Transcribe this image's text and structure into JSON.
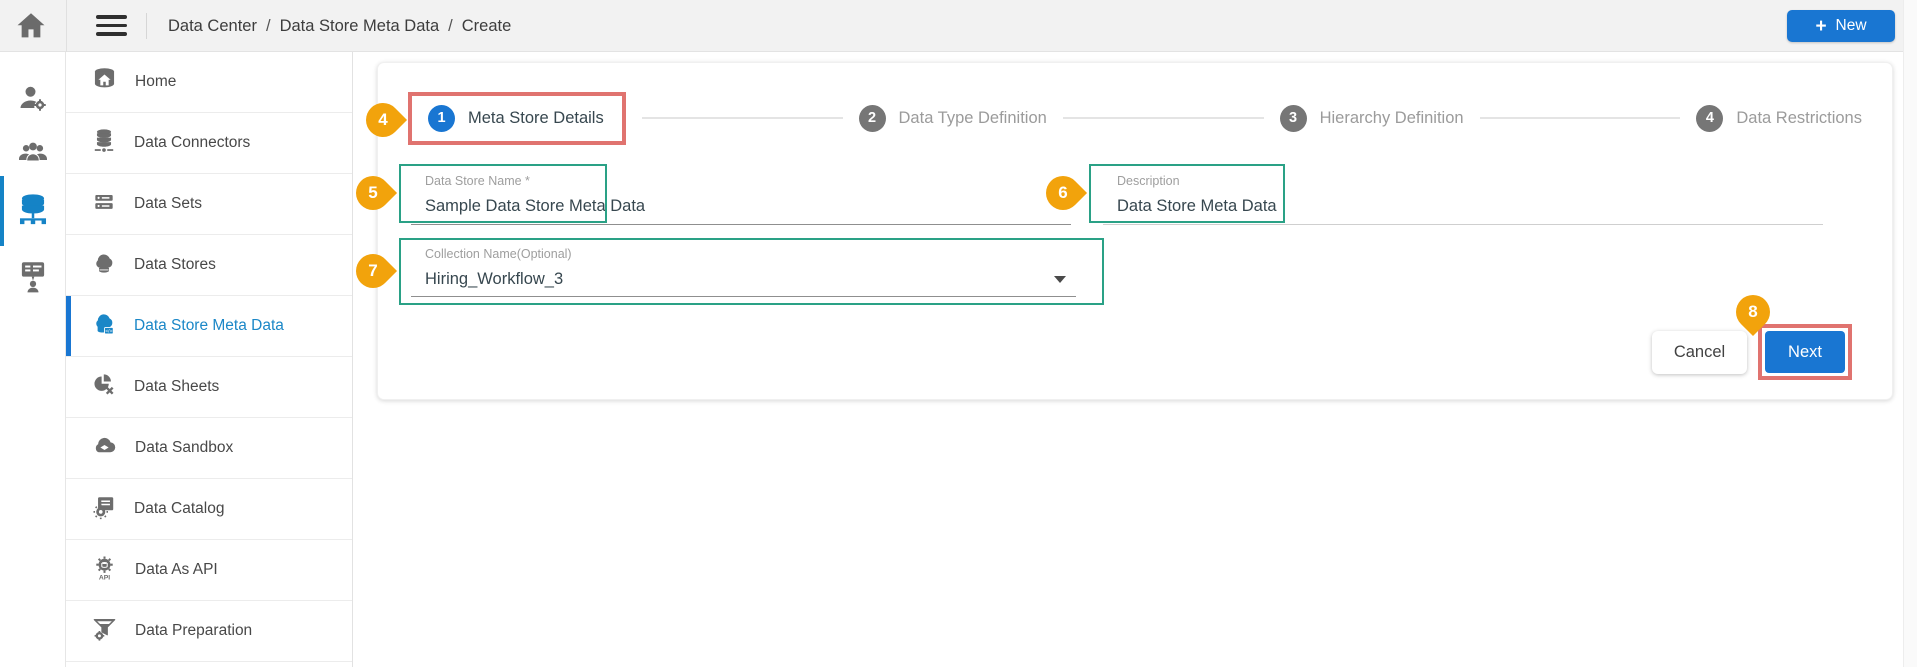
{
  "topbar": {
    "breadcrumb": {
      "items": [
        "Data Center",
        "Data Store Meta Data",
        "Create"
      ],
      "separator": "/"
    },
    "new_button": {
      "icon": "+",
      "label": "New"
    }
  },
  "rail": {
    "items": [
      {
        "icon": "home-icon",
        "active": false
      },
      {
        "icon": "user-settings-icon",
        "active": false
      },
      {
        "icon": "user-groups-icon",
        "active": false
      },
      {
        "icon": "data-center-server-icon",
        "active": true
      },
      {
        "icon": "training-board-icon",
        "active": false
      }
    ]
  },
  "sidebar": {
    "items": [
      {
        "label": "Home",
        "icon": "home-database-icon",
        "active": false
      },
      {
        "label": "Data Connectors",
        "icon": "database-network-icon",
        "active": false
      },
      {
        "label": "Data Sets",
        "icon": "server-stack-icon",
        "active": false
      },
      {
        "label": "Data Stores",
        "icon": "cloud-database-icon",
        "active": false
      },
      {
        "label": "Data Store Meta Data",
        "icon": "cloud-database-code-icon",
        "active": true
      },
      {
        "label": "Data Sheets",
        "icon": "data-sheets-icon",
        "active": false
      },
      {
        "label": "Data Sandbox",
        "icon": "cloud-icon",
        "active": false
      },
      {
        "label": "Data Catalog",
        "icon": "catalog-gear-icon",
        "active": false
      },
      {
        "label": "Data As API",
        "icon": "api-gear-icon",
        "active": false
      },
      {
        "label": "Data Preparation",
        "icon": "funnel-gear-icon",
        "active": false
      }
    ]
  },
  "stepper": {
    "steps": [
      {
        "number": "1",
        "label": "Meta Store Details",
        "state": "active"
      },
      {
        "number": "2",
        "label": "Data Type Definition",
        "state": "inactive"
      },
      {
        "number": "3",
        "label": "Hierarchy Definition",
        "state": "inactive"
      },
      {
        "number": "4",
        "label": "Data Restrictions",
        "state": "inactive"
      }
    ]
  },
  "form": {
    "data_store_name": {
      "label": "Data Store Name *",
      "value": "Sample Data Store Meta Data"
    },
    "description": {
      "label": "Description",
      "value": "Data Store Meta Data"
    },
    "collection_name": {
      "label": "Collection Name(Optional)",
      "value": "Hiring_Workflow_3"
    }
  },
  "actions": {
    "cancel": "Cancel",
    "next": "Next"
  },
  "annotations": {
    "badges": [
      {
        "number": "4",
        "target": "meta-store-details-step"
      },
      {
        "number": "5",
        "target": "data-store-name-field"
      },
      {
        "number": "6",
        "target": "description-field"
      },
      {
        "number": "7",
        "target": "collection-name-field"
      },
      {
        "number": "8",
        "target": "next-button"
      }
    ]
  },
  "colors": {
    "accent_blue": "#1976d2",
    "sidebar_active_blue": "#1b87c7",
    "rail_active_blue": "#1583c6",
    "annotation_red": "#e0736f",
    "annotation_green": "#2aa186",
    "badge_orange": "#f2a30c",
    "inactive_step_gray": "#767676",
    "topbar_gray": "#f2f2f2"
  }
}
